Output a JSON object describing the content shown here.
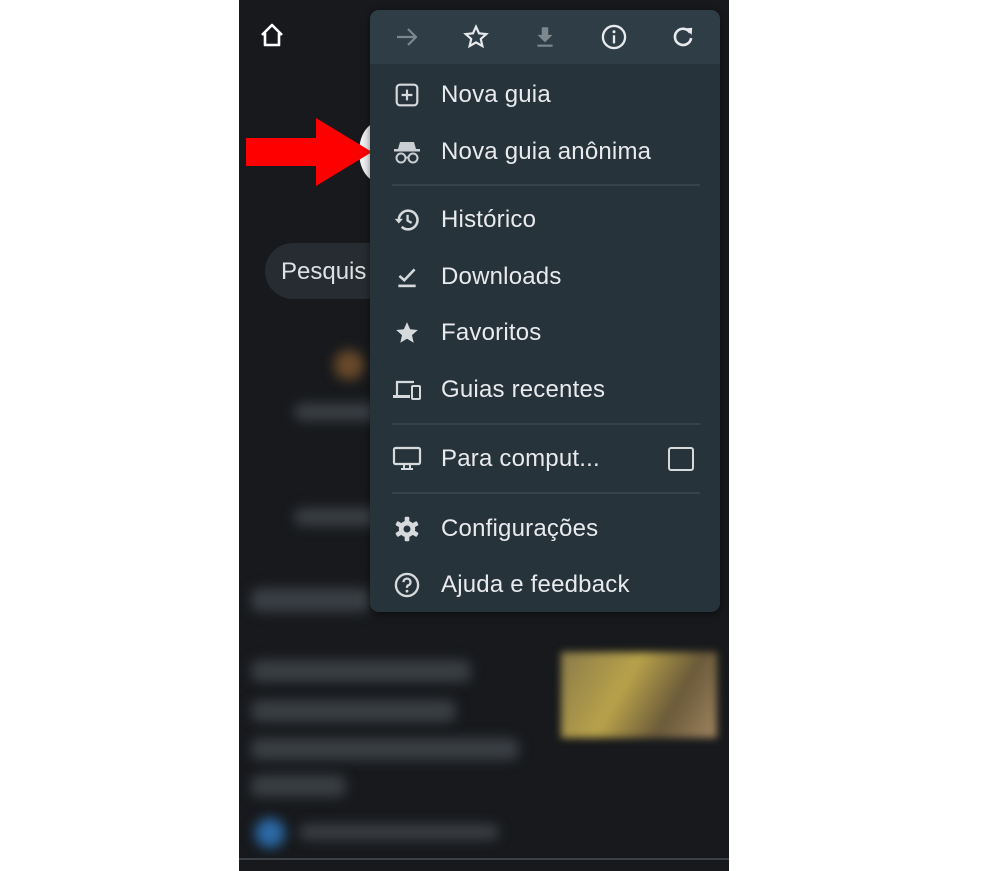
{
  "background": {
    "search_placeholder": "Pesquis"
  },
  "menu": {
    "toolbar": [
      {
        "icon": "forward-arrow-icon",
        "enabled": false
      },
      {
        "icon": "star-outline-icon",
        "enabled": true
      },
      {
        "icon": "download-icon",
        "enabled": false
      },
      {
        "icon": "info-icon",
        "enabled": true
      },
      {
        "icon": "refresh-icon",
        "enabled": true
      }
    ],
    "items": [
      {
        "label": "Nova guia",
        "icon": "new-tab-icon"
      },
      {
        "label": "Nova guia anônima",
        "icon": "incognito-icon"
      },
      {
        "label": "Histórico",
        "icon": "history-icon"
      },
      {
        "label": "Downloads",
        "icon": "downloads-check-icon"
      },
      {
        "label": "Favoritos",
        "icon": "star-icon"
      },
      {
        "label": "Guias recentes",
        "icon": "devices-icon"
      },
      {
        "label": "Para comput...",
        "icon": "desktop-icon",
        "checked": false
      },
      {
        "label": "Configurações",
        "icon": "gear-icon"
      },
      {
        "label": "Ajuda e feedback",
        "icon": "help-icon"
      }
    ]
  },
  "annotation": {
    "arrow_color": "#ff0000",
    "points_to": "Nova guia anônima"
  },
  "colors": {
    "menu_bg": "#27333b",
    "toolbar_bg": "#2e3d46",
    "page_bg": "#17191c",
    "text": "#e8eaed"
  }
}
